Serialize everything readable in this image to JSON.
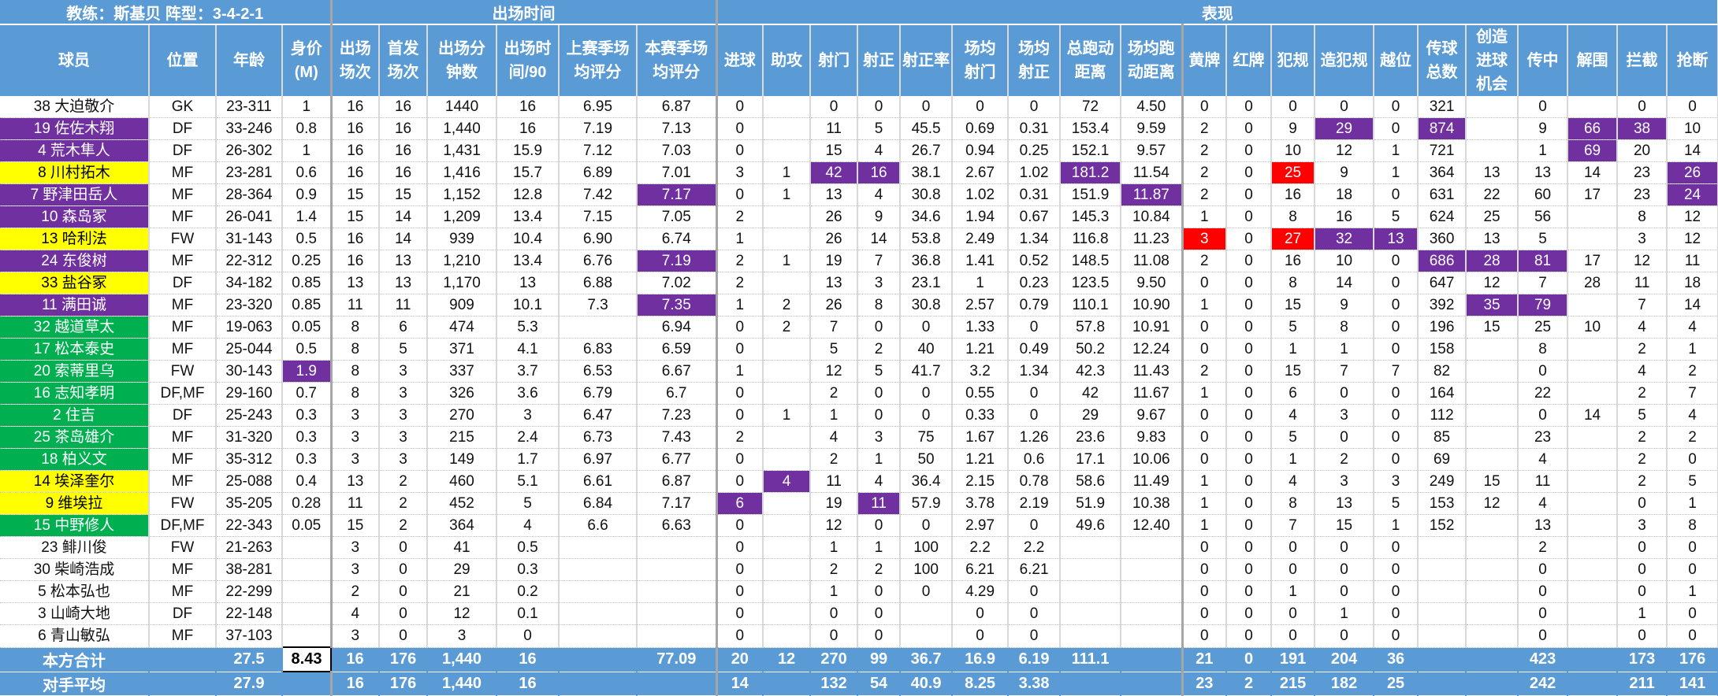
{
  "header": {
    "groups": [
      "教练：斯基贝  阵型：3-4-2-1",
      "出场时间",
      "表现"
    ],
    "columns": [
      "球员",
      "位置",
      "年龄",
      "身价\n(M)",
      "出场\n场次",
      "首发\n场次",
      "出场分\n钟数",
      "出场时\n间/90",
      "上赛季场\n均评分",
      "本赛季场\n均评分",
      "进球",
      "助攻",
      "射门",
      "射正",
      "射正率",
      "场均\n射门",
      "场均\n射正",
      "总跑动\n距离",
      "场均跑\n动距离",
      "黄牌",
      "红牌",
      "犯规",
      "造犯规",
      "越位",
      "传球\n总数",
      "创造\n进球\n机会",
      "传中",
      "解围",
      "拦截",
      "抢断"
    ]
  },
  "colors": {
    "header": "#5B9BD5",
    "purple": "#7030A0",
    "yellow": "#FFFF00",
    "green": "#00B050",
    "red": "#FF0000"
  },
  "rows": [
    {
      "name_bg": "white",
      "hl": {},
      "cells": [
        "38 大迫敬介",
        "GK",
        "23-311",
        "1",
        "16",
        "16",
        "1440",
        "16",
        "6.95",
        "6.87",
        "0",
        "",
        "0",
        "0",
        "0",
        "0",
        "0",
        "72",
        "4.50",
        "0",
        "0",
        "0",
        "0",
        "0",
        "321",
        "",
        "0",
        "",
        "0",
        "0"
      ]
    },
    {
      "name_bg": "purple",
      "hl": {
        "22": "purple",
        "24": "purple",
        "27": "purple",
        "28": "purple"
      },
      "cells": [
        "19 佐佐木翔",
        "DF",
        "33-246",
        "0.8",
        "16",
        "16",
        "1,440",
        "16",
        "7.19",
        "7.13",
        "0",
        "",
        "11",
        "5",
        "45.5",
        "0.69",
        "0.31",
        "153.4",
        "9.59",
        "2",
        "0",
        "9",
        "29",
        "0",
        "874",
        "",
        "9",
        "66",
        "38",
        "10"
      ]
    },
    {
      "name_bg": "purple",
      "hl": {
        "27": "purple"
      },
      "cells": [
        "4 荒木隼人",
        "DF",
        "26-302",
        "1",
        "16",
        "16",
        "1,431",
        "15.9",
        "7.12",
        "7.03",
        "0",
        "",
        "15",
        "4",
        "26.7",
        "0.94",
        "0.25",
        "152.1",
        "9.57",
        "2",
        "0",
        "10",
        "12",
        "1",
        "721",
        "",
        "1",
        "69",
        "20",
        "14"
      ]
    },
    {
      "name_bg": "yellow",
      "hl": {
        "12": "purple",
        "13": "purple",
        "17": "purple",
        "21": "red",
        "29": "purple"
      },
      "cells": [
        "8 川村拓木",
        "MF",
        "23-281",
        "0.6",
        "16",
        "16",
        "1,416",
        "15.7",
        "6.89",
        "7.01",
        "3",
        "1",
        "42",
        "16",
        "38.1",
        "2.67",
        "1.02",
        "181.2",
        "11.54",
        "2",
        "0",
        "25",
        "9",
        "1",
        "364",
        "13",
        "13",
        "14",
        "23",
        "26"
      ]
    },
    {
      "name_bg": "purple",
      "hl": {
        "9": "purple",
        "18": "purple",
        "29": "purple"
      },
      "cells": [
        "7 野津田岳人",
        "MF",
        "28-364",
        "0.9",
        "15",
        "15",
        "1,152",
        "12.8",
        "7.42",
        "7.17",
        "0",
        "1",
        "13",
        "4",
        "30.8",
        "1.02",
        "0.31",
        "151.9",
        "11.87",
        "2",
        "0",
        "16",
        "18",
        "0",
        "631",
        "22",
        "60",
        "17",
        "23",
        "24"
      ]
    },
    {
      "name_bg": "purple",
      "hl": {},
      "cells": [
        "10 森岛冢",
        "MF",
        "26-041",
        "1.4",
        "15",
        "14",
        "1,209",
        "13.4",
        "7.15",
        "7.05",
        "2",
        "",
        "26",
        "9",
        "34.6",
        "1.94",
        "0.67",
        "145.3",
        "10.84",
        "1",
        "0",
        "8",
        "16",
        "5",
        "624",
        "25",
        "56",
        "",
        "8",
        "12"
      ]
    },
    {
      "name_bg": "yellow",
      "hl": {
        "19": "red",
        "21": "red",
        "22": "purple",
        "23": "purple"
      },
      "cells": [
        "13 哈利法",
        "FW",
        "31-143",
        "0.5",
        "16",
        "14",
        "939",
        "10.4",
        "6.90",
        "6.74",
        "1",
        "",
        "26",
        "14",
        "53.8",
        "2.49",
        "1.34",
        "116.8",
        "11.23",
        "3",
        "0",
        "27",
        "32",
        "13",
        "360",
        "13",
        "5",
        "",
        "3",
        "12"
      ]
    },
    {
      "name_bg": "purple",
      "hl": {
        "9": "purple",
        "24": "purple",
        "25": "purple",
        "26": "purple"
      },
      "cells": [
        "24 东俊树",
        "MF",
        "22-312",
        "0.25",
        "16",
        "13",
        "1,210",
        "13.4",
        "6.76",
        "7.19",
        "2",
        "1",
        "19",
        "7",
        "36.8",
        "1.41",
        "0.52",
        "148.5",
        "11.08",
        "2",
        "0",
        "16",
        "10",
        "0",
        "686",
        "28",
        "81",
        "17",
        "12",
        "11"
      ]
    },
    {
      "name_bg": "yellow",
      "hl": {},
      "cells": [
        "33 盐谷冢",
        "DF",
        "34-182",
        "0.85",
        "13",
        "13",
        "1,170",
        "13",
        "6.88",
        "7.02",
        "2",
        "",
        "13",
        "3",
        "23.1",
        "1",
        "0.23",
        "123.5",
        "9.50",
        "0",
        "0",
        "8",
        "14",
        "0",
        "647",
        "12",
        "7",
        "28",
        "11",
        "18"
      ]
    },
    {
      "name_bg": "purple",
      "hl": {
        "9": "purple",
        "25": "purple",
        "26": "purple"
      },
      "cells": [
        "11 满田诚",
        "MF",
        "23-320",
        "0.85",
        "11",
        "11",
        "909",
        "10.1",
        "7.3",
        "7.35",
        "1",
        "2",
        "26",
        "8",
        "30.8",
        "2.57",
        "0.79",
        "110.1",
        "10.90",
        "1",
        "0",
        "15",
        "9",
        "0",
        "392",
        "35",
        "79",
        "",
        "7",
        "14"
      ]
    },
    {
      "name_bg": "green",
      "hl": {},
      "cells": [
        "32 越道草太",
        "MF",
        "19-063",
        "0.05",
        "8",
        "6",
        "474",
        "5.3",
        "",
        "6.94",
        "0",
        "2",
        "7",
        "0",
        "0",
        "1.33",
        "0",
        "57.8",
        "10.91",
        "0",
        "0",
        "5",
        "8",
        "0",
        "196",
        "15",
        "25",
        "10",
        "4",
        "4"
      ]
    },
    {
      "name_bg": "green",
      "hl": {},
      "cells": [
        "17 松本泰史",
        "MF",
        "25-044",
        "0.5",
        "8",
        "5",
        "371",
        "4.1",
        "6.83",
        "6.59",
        "0",
        "",
        "5",
        "2",
        "40",
        "1.21",
        "0.49",
        "50.2",
        "12.24",
        "0",
        "0",
        "1",
        "1",
        "0",
        "158",
        "",
        "8",
        "",
        "2",
        "1"
      ]
    },
    {
      "name_bg": "green",
      "hl": {
        "3": "purple"
      },
      "cells": [
        "20 索蒂里乌",
        "FW",
        "30-143",
        "1.9",
        "8",
        "3",
        "337",
        "3.7",
        "6.53",
        "6.67",
        "1",
        "",
        "12",
        "5",
        "41.7",
        "3.2",
        "1.34",
        "42.3",
        "11.43",
        "2",
        "0",
        "15",
        "7",
        "7",
        "82",
        "",
        "0",
        "",
        "4",
        "2"
      ]
    },
    {
      "name_bg": "green",
      "hl": {},
      "cells": [
        "16 志知孝明",
        "DF,MF",
        "29-160",
        "0.7",
        "8",
        "3",
        "326",
        "3.6",
        "6.79",
        "6.7",
        "0",
        "",
        "2",
        "0",
        "0",
        "0.55",
        "0",
        "42",
        "11.67",
        "1",
        "0",
        "6",
        "0",
        "0",
        "164",
        "",
        "22",
        "",
        "2",
        "7"
      ]
    },
    {
      "name_bg": "green",
      "hl": {},
      "cells": [
        "2 住吉",
        "DF",
        "25-243",
        "0.3",
        "3",
        "3",
        "270",
        "3",
        "6.47",
        "7.23",
        "0",
        "1",
        "1",
        "0",
        "0",
        "0.33",
        "0",
        "29",
        "9.67",
        "0",
        "0",
        "4",
        "3",
        "0",
        "112",
        "",
        "0",
        "14",
        "5",
        "4"
      ]
    },
    {
      "name_bg": "green",
      "hl": {},
      "cells": [
        "25 茶岛雄介",
        "MF",
        "31-320",
        "0.3",
        "3",
        "3",
        "215",
        "2.4",
        "6.73",
        "7.43",
        "2",
        "",
        "4",
        "3",
        "75",
        "1.67",
        "1.26",
        "23.6",
        "9.83",
        "0",
        "0",
        "5",
        "0",
        "0",
        "85",
        "",
        "23",
        "",
        "2",
        "2"
      ]
    },
    {
      "name_bg": "green",
      "hl": {},
      "cells": [
        "18 柏义文",
        "MF",
        "35-312",
        "0.3",
        "3",
        "3",
        "149",
        "1.7",
        "6.97",
        "6.77",
        "0",
        "",
        "2",
        "1",
        "50",
        "1.21",
        "0.6",
        "17.1",
        "10.06",
        "0",
        "0",
        "1",
        "2",
        "0",
        "69",
        "",
        "4",
        "",
        "2",
        "0"
      ]
    },
    {
      "name_bg": "yellow",
      "hl": {
        "11": "purple"
      },
      "cells": [
        "14 埃泽奎尔",
        "MF",
        "25-088",
        "0.4",
        "13",
        "2",
        "460",
        "5.1",
        "6.61",
        "6.87",
        "0",
        "4",
        "11",
        "4",
        "36.4",
        "2.15",
        "0.78",
        "58.6",
        "11.49",
        "1",
        "0",
        "4",
        "3",
        "3",
        "249",
        "15",
        "11",
        "",
        "2",
        "5"
      ]
    },
    {
      "name_bg": "yellow",
      "hl": {
        "10": "purple",
        "13": "purple"
      },
      "cells": [
        "9 维埃拉",
        "FW",
        "35-205",
        "0.28",
        "11",
        "2",
        "452",
        "5",
        "6.84",
        "7.17",
        "6",
        "",
        "19",
        "11",
        "57.9",
        "3.78",
        "2.19",
        "51.9",
        "10.38",
        "1",
        "0",
        "8",
        "13",
        "5",
        "153",
        "12",
        "4",
        "",
        "0",
        "1"
      ]
    },
    {
      "name_bg": "green",
      "hl": {},
      "cells": [
        "15 中野修人",
        "DF,MF",
        "22-343",
        "0.05",
        "15",
        "2",
        "364",
        "4",
        "6.6",
        "6.63",
        "0",
        "",
        "12",
        "0",
        "0",
        "2.97",
        "0",
        "49.6",
        "12.40",
        "1",
        "0",
        "7",
        "15",
        "1",
        "152",
        "",
        "13",
        "",
        "3",
        "8"
      ]
    },
    {
      "name_bg": "white",
      "hl": {},
      "cells": [
        "23 鲱川俊",
        "FW",
        "21-263",
        "",
        "3",
        "0",
        "41",
        "0.5",
        "",
        "",
        "0",
        "",
        "1",
        "1",
        "100",
        "2.2",
        "2.2",
        "",
        "",
        "0",
        "0",
        "0",
        "0",
        "0",
        "",
        "",
        "2",
        "",
        "0",
        "0"
      ]
    },
    {
      "name_bg": "white",
      "hl": {},
      "cells": [
        "30 柴崎浩成",
        "MF",
        "38-281",
        "",
        "3",
        "0",
        "29",
        "0.3",
        "",
        "",
        "0",
        "",
        "2",
        "2",
        "100",
        "6.21",
        "6.21",
        "",
        "",
        "0",
        "0",
        "0",
        "0",
        "0",
        "",
        "",
        "0",
        "",
        "0",
        "0"
      ]
    },
    {
      "name_bg": "white",
      "hl": {},
      "cells": [
        "5 松本弘也",
        "MF",
        "22-299",
        "",
        "2",
        "0",
        "21",
        "0.2",
        "",
        "",
        "0",
        "",
        "1",
        "0",
        "0",
        "4.29",
        "0",
        "",
        "",
        "0",
        "0",
        "1",
        "0",
        "0",
        "",
        "",
        "0",
        "",
        "0",
        "1"
      ]
    },
    {
      "name_bg": "white",
      "hl": {},
      "cells": [
        "3 山崎大地",
        "DF",
        "22-148",
        "",
        "4",
        "0",
        "12",
        "0.1",
        "",
        "",
        "0",
        "",
        "0",
        "0",
        "",
        "0",
        "0",
        "",
        "",
        "0",
        "0",
        "0",
        "1",
        "0",
        "",
        "",
        "0",
        "",
        "1",
        "0"
      ]
    },
    {
      "name_bg": "white",
      "hl": {},
      "cells": [
        "6 青山敏弘",
        "MF",
        "37-103",
        "",
        "3",
        "0",
        "3",
        "0",
        "",
        "",
        "0",
        "",
        "0",
        "0",
        "",
        "0",
        "0",
        "",
        "",
        "0",
        "0",
        "0",
        "0",
        "0",
        "",
        "",
        "0",
        "",
        "0",
        "0"
      ]
    }
  ],
  "totals": [
    {
      "cells": [
        "本方合计",
        "",
        "27.5",
        "8.43",
        "16",
        "176",
        "1,440",
        "16",
        "",
        "77.09",
        "20",
        "12",
        "270",
        "99",
        "36.7",
        "16.9",
        "6.19",
        "111.1",
        "",
        "21",
        "0",
        "191",
        "204",
        "36",
        "",
        "",
        "423",
        "",
        "173",
        "176"
      ]
    },
    {
      "cells": [
        "对手平均",
        "",
        "27.9",
        "",
        "16",
        "176",
        "1,440",
        "16",
        "",
        "",
        "14",
        "",
        "132",
        "54",
        "40.9",
        "8.25",
        "3.38",
        "",
        "",
        "23",
        "2",
        "215",
        "182",
        "25",
        "",
        "",
        "242",
        "",
        "211",
        "141"
      ]
    }
  ]
}
